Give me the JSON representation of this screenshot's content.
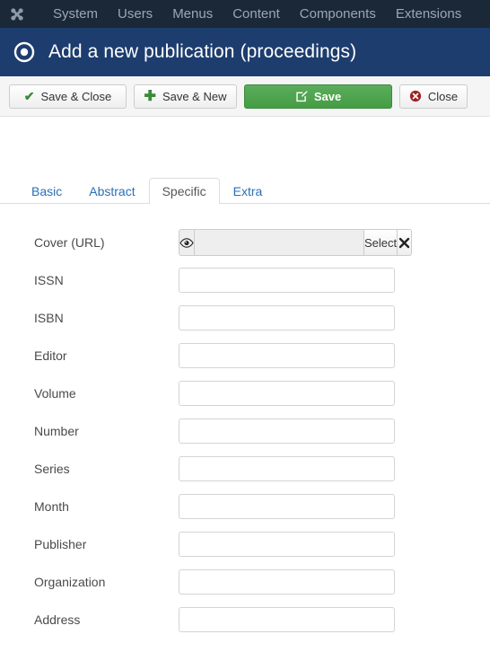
{
  "topbar": {
    "logo_icon": "joomla-logo-icon",
    "items": [
      {
        "label": "System"
      },
      {
        "label": "Users"
      },
      {
        "label": "Menus"
      },
      {
        "label": "Content"
      },
      {
        "label": "Components"
      },
      {
        "label": "Extensions"
      }
    ]
  },
  "titlebar": {
    "icon": "bullseye-icon",
    "title": "Add a new publication (proceedings)",
    "background_color": "#1d3d6e"
  },
  "toolbar": {
    "buttons": [
      {
        "label": "Save & Close",
        "icon": "check-icon",
        "style": "default"
      },
      {
        "label": "Save & New",
        "icon": "plus-icon",
        "style": "default"
      },
      {
        "label": "Save",
        "icon": "pencil-square-icon",
        "style": "primary-green",
        "color": "#449d44"
      },
      {
        "label": "Close",
        "icon": "circle-x-icon",
        "style": "default",
        "icon_color": "#a02020"
      }
    ]
  },
  "tabs": [
    {
      "label": "Basic",
      "active": false
    },
    {
      "label": "Abstract",
      "active": false
    },
    {
      "label": "Specific",
      "active": true
    },
    {
      "label": "Extra",
      "active": false
    }
  ],
  "form": {
    "cover": {
      "label": "Cover (URL)",
      "value": "",
      "placeholder": "",
      "preview_icon": "eye-icon",
      "select_label": "Select",
      "clear_icon": "x-icon"
    },
    "fields": [
      {
        "label": "ISSN",
        "value": "",
        "placeholder": ""
      },
      {
        "label": "ISBN",
        "value": "",
        "placeholder": ""
      },
      {
        "label": "Editor",
        "value": "",
        "placeholder": ""
      },
      {
        "label": "Volume",
        "value": "",
        "placeholder": ""
      },
      {
        "label": "Number",
        "value": "",
        "placeholder": ""
      },
      {
        "label": "Series",
        "value": "",
        "placeholder": ""
      },
      {
        "label": "Month",
        "value": "",
        "placeholder": ""
      },
      {
        "label": "Publisher",
        "value": "",
        "placeholder": ""
      },
      {
        "label": "Organization",
        "value": "",
        "placeholder": ""
      },
      {
        "label": "Address",
        "value": "",
        "placeholder": ""
      }
    ]
  }
}
